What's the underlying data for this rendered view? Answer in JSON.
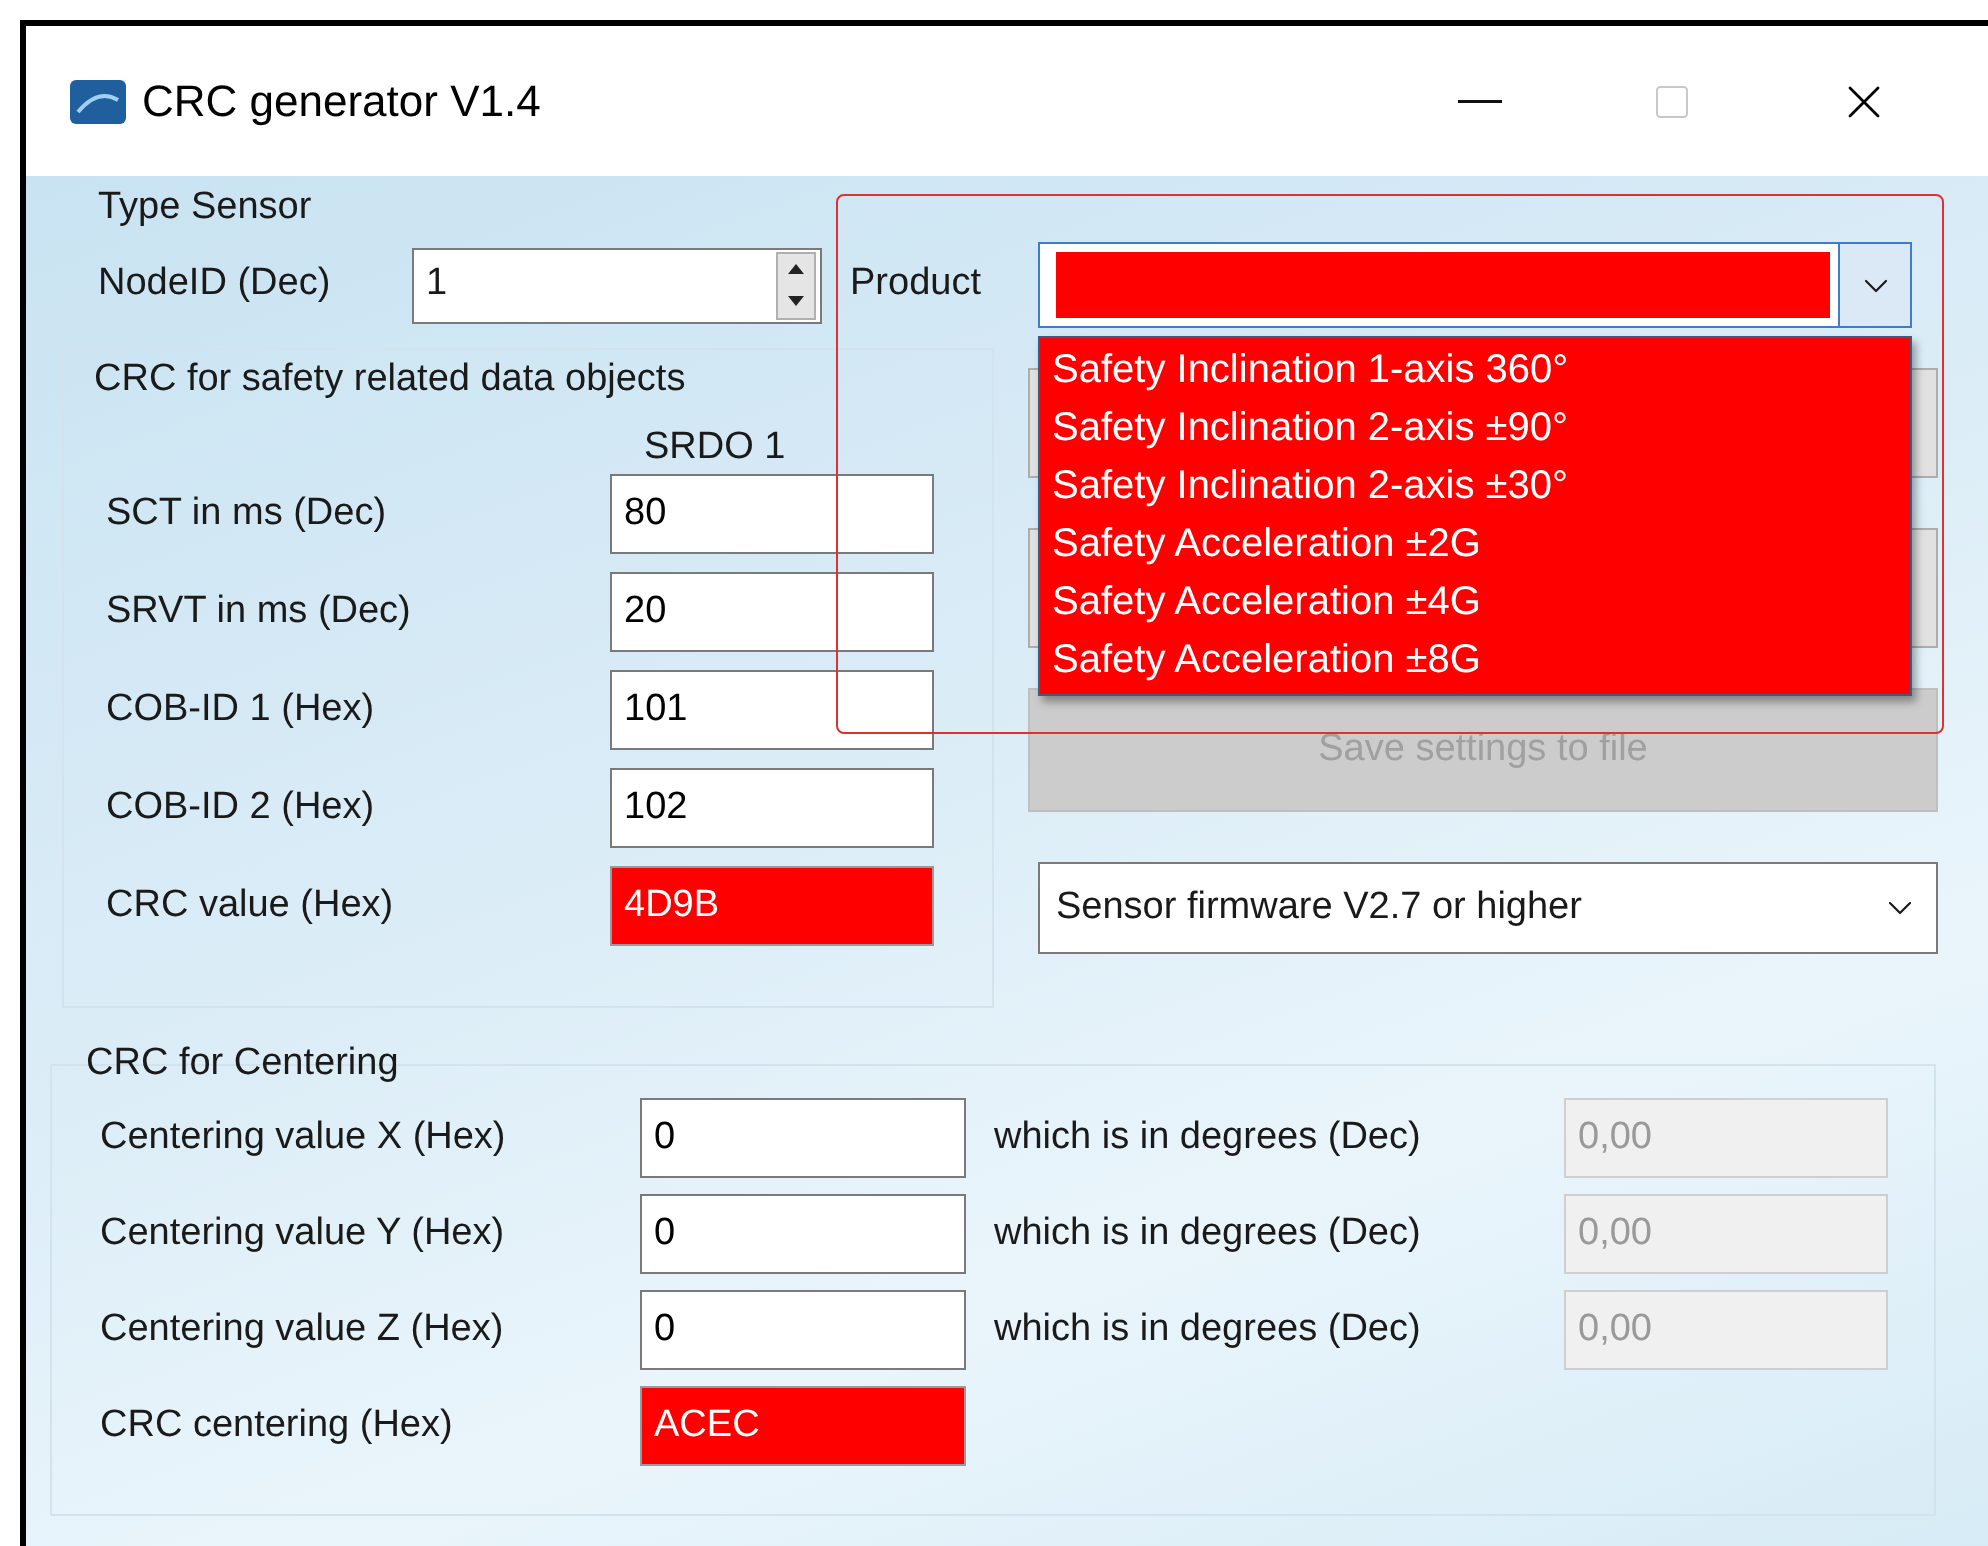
{
  "window": {
    "title": "CRC generator V1.4"
  },
  "type_sensor": {
    "title": "Type Sensor",
    "node_id": {
      "label": "NodeID (Dec)",
      "value": "1"
    }
  },
  "product": {
    "label": "Product",
    "invalid": true,
    "expanded": true,
    "highlighted": true,
    "options": [
      {
        "label": "Safety Inclination 1-axis 360°",
        "selected": false
      },
      {
        "label": "Safety Inclination 2-axis ±90°",
        "selected": false
      },
      {
        "label": "Safety Inclination 2-axis ±30°",
        "selected": false
      },
      {
        "label": "Safety Acceleration ±2G",
        "selected": false
      },
      {
        "label": "Safety Acceleration ±4G",
        "selected": false
      },
      {
        "label": "Safety Acceleration ±8G",
        "selected": false
      }
    ]
  },
  "safety_crc": {
    "title": "CRC for safety related data objects",
    "column": "SRDO 1",
    "rows": [
      {
        "label": "SCT in ms (Dec)",
        "value": "80",
        "kind": "input"
      },
      {
        "label": "SRVT in ms (Dec)",
        "value": "20",
        "kind": "input"
      },
      {
        "label": "COB-ID 1 (Hex)",
        "value": "101",
        "kind": "input"
      },
      {
        "label": "COB-ID 2 (Hex)",
        "value": "102",
        "kind": "input"
      },
      {
        "label": "CRC value (Hex)",
        "value": "4D9B",
        "kind": "result"
      }
    ]
  },
  "buttons": [
    {
      "disabled": false
    },
    {
      "disabled": false
    },
    {
      "label": "Save settings to file",
      "disabled": true
    }
  ],
  "firmware": {
    "value": "Sensor firmware V2.7 or higher"
  },
  "centering": {
    "title": "CRC for Centering",
    "rows": [
      {
        "label": "Centering value X (Hex)",
        "value": "0",
        "degrees_label": "which is in degrees (Dec)",
        "degrees": "0,00"
      },
      {
        "label": "Centering value Y (Hex)",
        "value": "0",
        "degrees_label": "which is in degrees (Dec)",
        "degrees": "0,00"
      },
      {
        "label": "Centering value Z (Hex)",
        "value": "0",
        "degrees_label": "which is in degrees (Dec)",
        "degrees": "0,00"
      }
    ],
    "crc": {
      "label": "CRC centering (Hex)",
      "value": "ACEC",
      "kind": "result"
    }
  }
}
